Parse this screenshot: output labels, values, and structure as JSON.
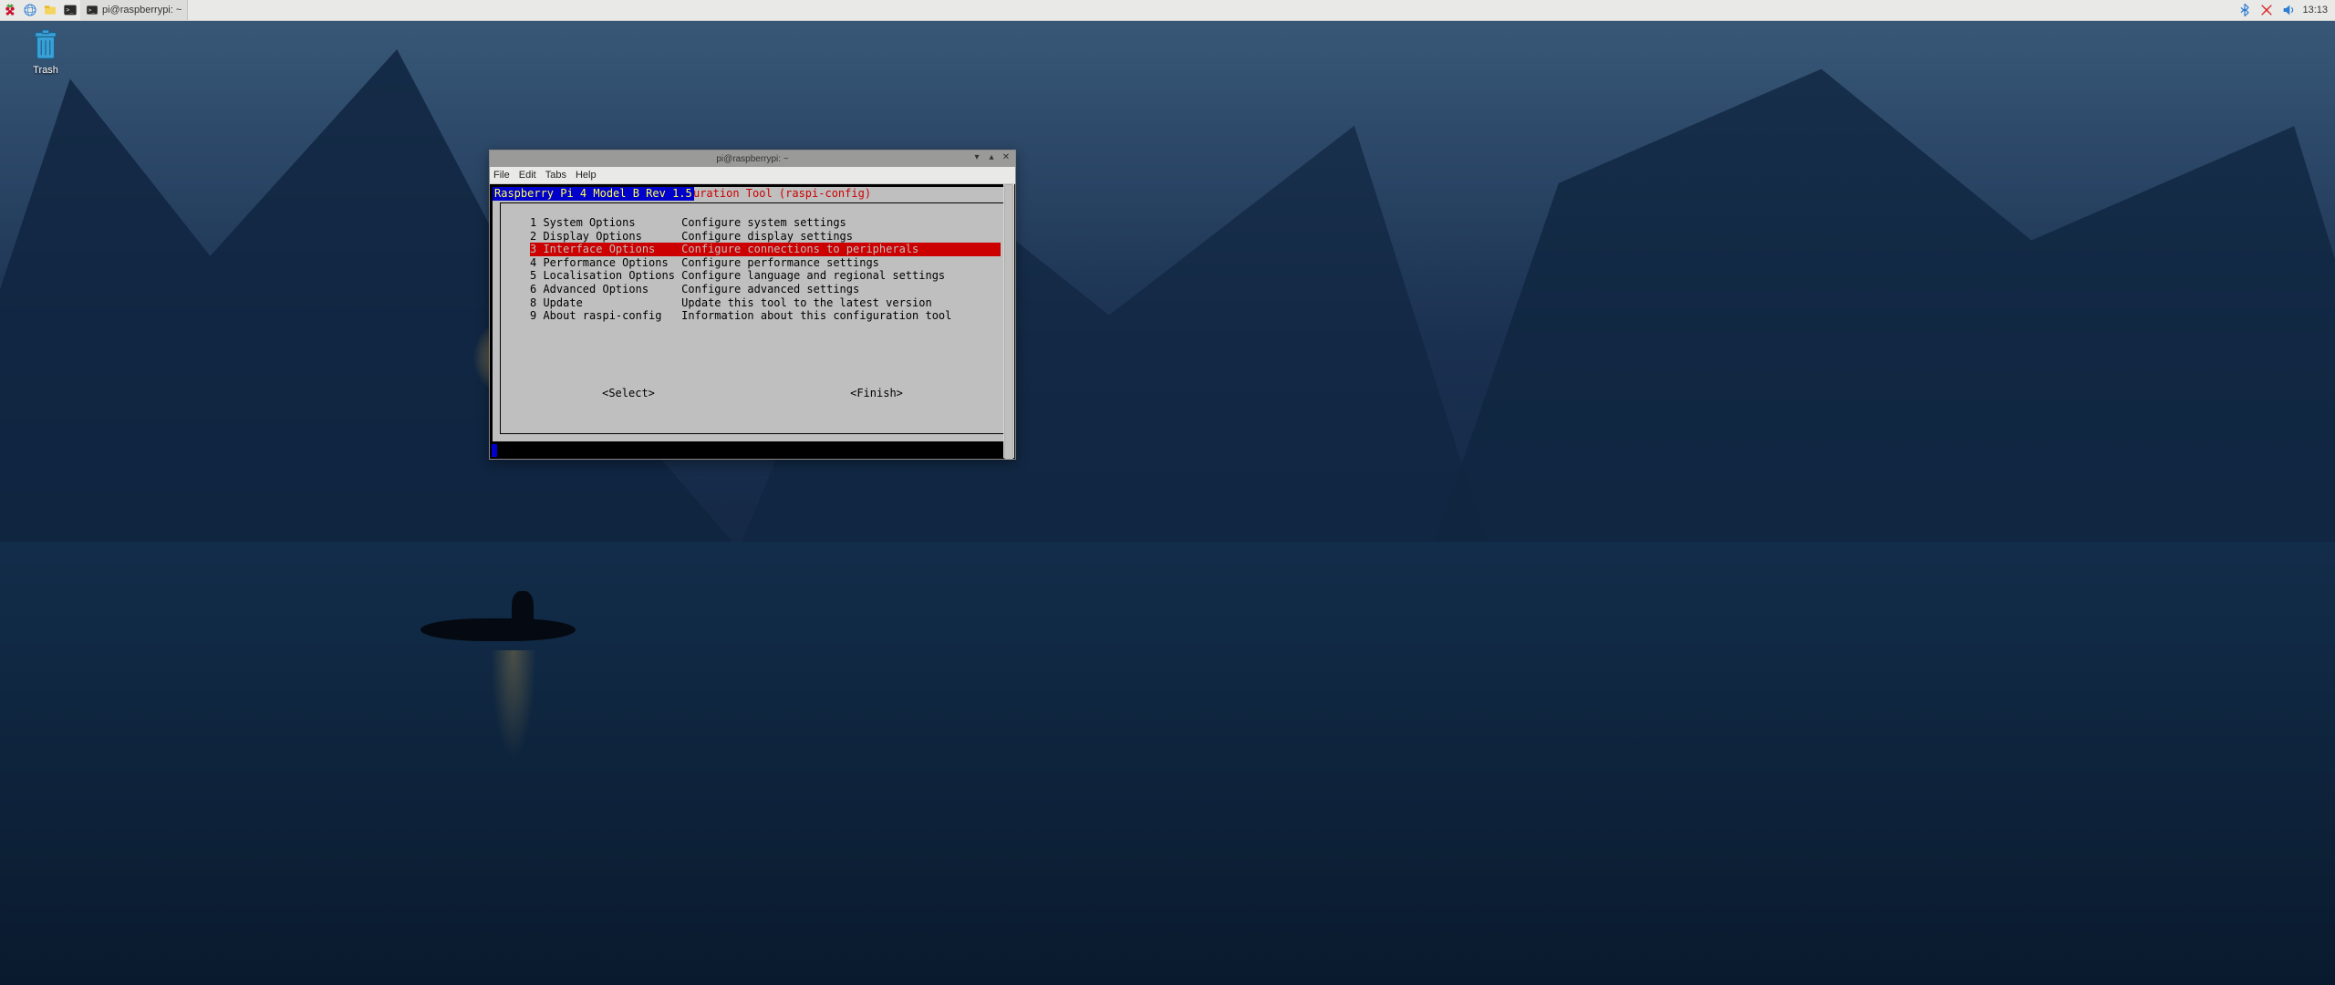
{
  "taskbar": {
    "task_label": "pi@raspberrypi: ~",
    "clock": "13:13"
  },
  "desktop": {
    "trash_label": "Trash"
  },
  "window": {
    "title": "pi@raspberrypi: ~",
    "menu": {
      "file": "File",
      "edit": "Edit",
      "tabs": "Tabs",
      "help": "Help"
    }
  },
  "raspi": {
    "hw": "Raspberry Pi 4 Model B Rev 1.5",
    "tool_suffix": "re Configuration Tool (raspi-config)",
    "items": [
      {
        "n": "1",
        "label": "System Options",
        "desc": "Configure system settings"
      },
      {
        "n": "2",
        "label": "Display Options",
        "desc": "Configure display settings"
      },
      {
        "n": "3",
        "label": "Interface Options",
        "desc": "Configure connections to peripherals"
      },
      {
        "n": "4",
        "label": "Performance Options",
        "desc": "Configure performance settings"
      },
      {
        "n": "5",
        "label": "Localisation Options",
        "desc": "Configure language and regional settings"
      },
      {
        "n": "6",
        "label": "Advanced Options",
        "desc": "Configure advanced settings"
      },
      {
        "n": "8",
        "label": "Update",
        "desc": "Update this tool to the latest version"
      },
      {
        "n": "9",
        "label": "About raspi-config",
        "desc": "Information about this configuration tool"
      }
    ],
    "selected_index": 2,
    "select_btn": "<Select>",
    "finish_btn": "<Finish>"
  }
}
